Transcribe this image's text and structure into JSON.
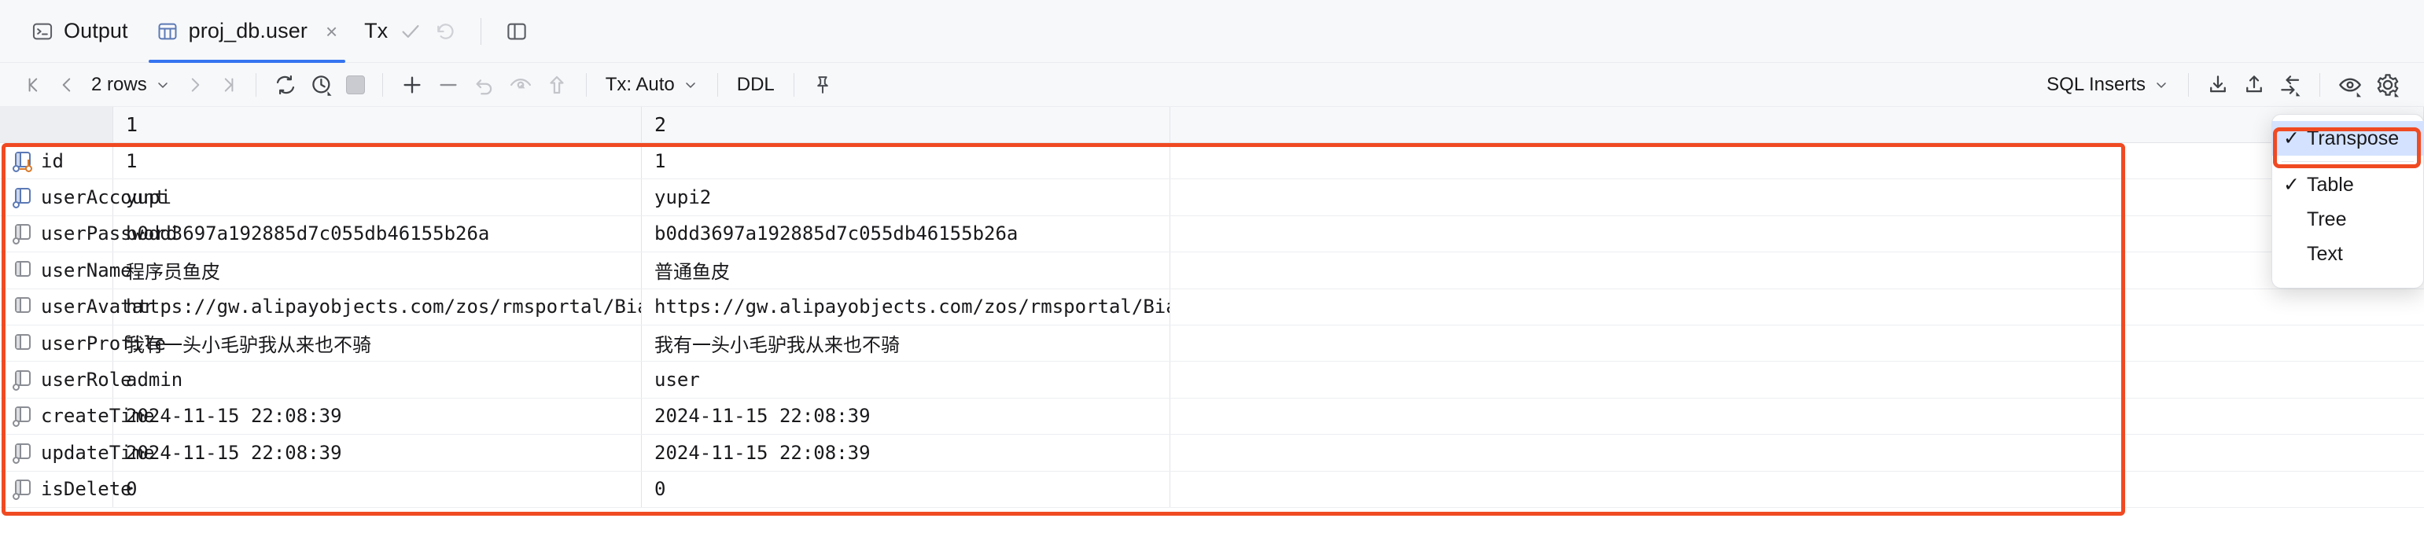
{
  "tabbar": {
    "tabs": [
      {
        "label": "Output",
        "icon": "terminal-icon",
        "active": false,
        "closable": false
      },
      {
        "label": "proj_db.user",
        "icon": "table-icon",
        "active": true,
        "closable": true,
        "close_glyph": "×"
      }
    ],
    "tx_label": "Tx",
    "icons": [
      "commit-check-icon",
      "rollback-icon",
      "split-editor-icon"
    ]
  },
  "toolbar": {
    "nav": {
      "first_page": "|<",
      "prev_page": "<",
      "rows_label": "2 rows",
      "next_page": ">",
      "last_page": ">|"
    },
    "actions": [
      {
        "name": "reload-icon",
        "label": ""
      },
      {
        "name": "history-icon",
        "label": ""
      },
      {
        "name": "stop-icon",
        "label": ""
      },
      {
        "name": "add-row-icon",
        "label": "+"
      },
      {
        "name": "delete-row-icon",
        "label": "−"
      },
      {
        "name": "revert-icon",
        "label": ""
      },
      {
        "name": "preview-changes-icon",
        "label": ""
      },
      {
        "name": "submit-icon",
        "label": ""
      }
    ],
    "tx_mode": "Tx: Auto",
    "ddl_label": "DDL",
    "pin_icon": "pin-icon",
    "export_format": "SQL Inserts",
    "right_icons": [
      "import-icon",
      "export-icon",
      "data-extractor-icon",
      "view-options-icon",
      "settings-icon"
    ]
  },
  "grid": {
    "column_headers": [
      "",
      "1",
      "2",
      ""
    ],
    "rows": [
      {
        "field": "id",
        "icon": "primary-key-column-icon",
        "values": [
          "1",
          "1"
        ]
      },
      {
        "field": "userAccount",
        "icon": "indexed-column-icon",
        "values": [
          "yupi",
          "yupi2"
        ]
      },
      {
        "field": "userPassword",
        "icon": "column-icon",
        "values": [
          "b0dd3697a192885d7c055db46155b26a",
          "b0dd3697a192885d7c055db46155b26a"
        ]
      },
      {
        "field": "userName",
        "icon": "plain-column-icon",
        "values": [
          "程序员鱼皮",
          "普通鱼皮"
        ]
      },
      {
        "field": "userAvatar",
        "icon": "plain-column-icon",
        "values": [
          "https://gw.alipayobjects.com/zos/rmsportal/BiazfanxmamNRoxxVxka.png",
          "https://gw.alipayobjects.com/zos/rmsportal/BiazfanxmamNRoxxVxka.png"
        ]
      },
      {
        "field": "userProfile",
        "icon": "plain-column-icon",
        "values": [
          "我有一头小毛驴我从来也不骑",
          "我有一头小毛驴我从来也不骑"
        ]
      },
      {
        "field": "userRole",
        "icon": "column-icon",
        "values": [
          "admin",
          "user"
        ]
      },
      {
        "field": "createTime",
        "icon": "column-icon",
        "values": [
          "2024-11-15 22:08:39",
          "2024-11-15 22:08:39"
        ]
      },
      {
        "field": "updateTime",
        "icon": "column-icon",
        "values": [
          "2024-11-15 22:08:39",
          "2024-11-15 22:08:39"
        ]
      },
      {
        "field": "isDelete",
        "icon": "column-icon",
        "values": [
          "0",
          "0"
        ]
      }
    ]
  },
  "view_menu": {
    "items": [
      {
        "label": "Transpose",
        "checked": true,
        "highlighted": true
      },
      {
        "label": "Table",
        "checked": true,
        "highlighted": false
      },
      {
        "label": "Tree",
        "checked": false,
        "highlighted": false
      },
      {
        "label": "Text",
        "checked": false,
        "highlighted": false
      }
    ],
    "check_glyph": "✓"
  },
  "annotations": {
    "accent_color": "#f04a23",
    "highlight_color": "#d4e2ff"
  }
}
